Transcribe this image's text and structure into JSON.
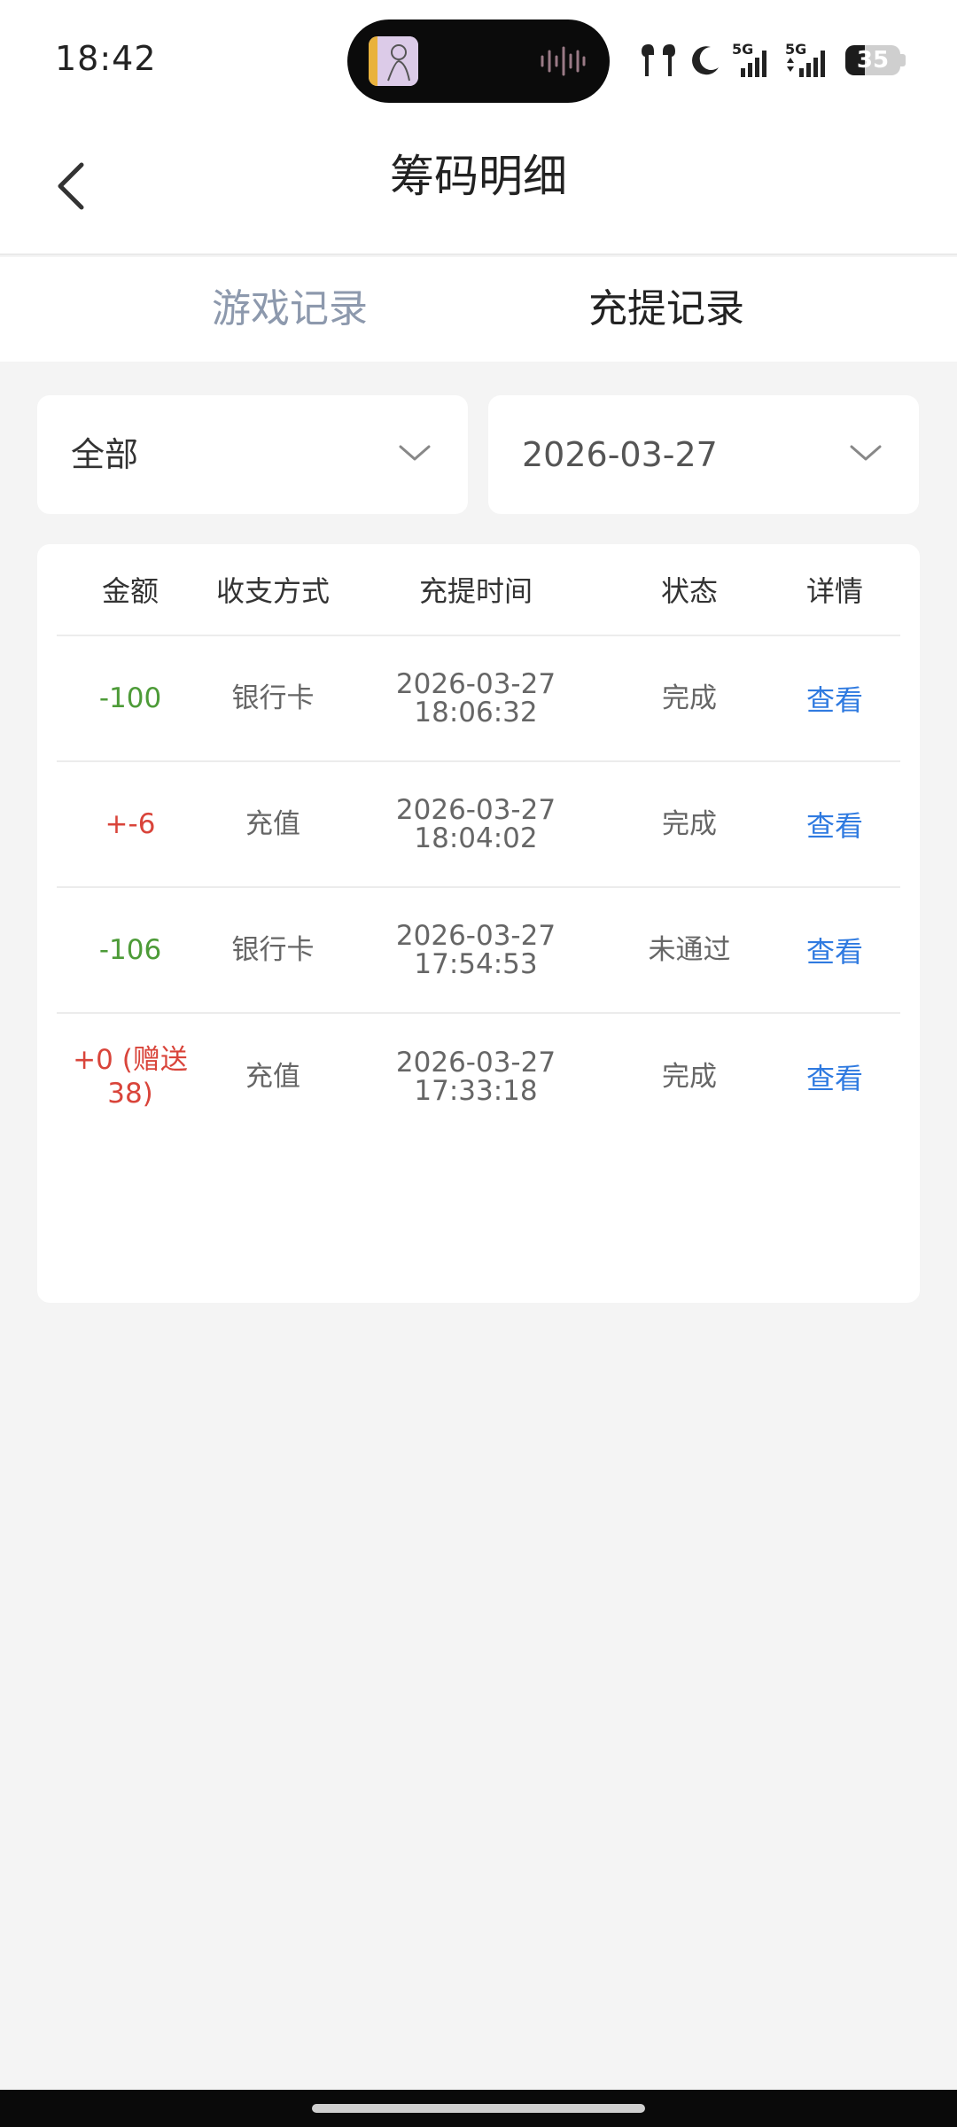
{
  "status_bar": {
    "time": "18:42",
    "battery_level": "35",
    "battery_fraction": 0.35,
    "network_1": "5G",
    "network_2": "5G"
  },
  "header": {
    "title": "筹码明细",
    "back_icon": "chevron-left-icon"
  },
  "tabs": [
    {
      "label": "游戏记录",
      "active": false
    },
    {
      "label": "充提记录",
      "active": true
    }
  ],
  "filters": {
    "type_value": "全部",
    "date_value": "2026-03-27"
  },
  "table": {
    "headers": [
      "金额",
      "收支方式",
      "充提时间",
      "状态",
      "详情"
    ],
    "rows": [
      {
        "amount": "-100",
        "method": "银行卡",
        "date": "2026-03-27",
        "time": "18:06:32",
        "status": "完成",
        "action": "查看",
        "sign": "neg"
      },
      {
        "amount": "+-6",
        "method": "充值",
        "date": "2026-03-27",
        "time": "18:04:02",
        "status": "完成",
        "action": "查看",
        "sign": "pos"
      },
      {
        "amount": "-106",
        "method": "银行卡",
        "date": "2026-03-27",
        "time": "17:54:53",
        "status": "未通过",
        "action": "查看",
        "sign": "neg"
      },
      {
        "amount": "+0 (赠送38)",
        "method": "充值",
        "date": "2026-03-27",
        "time": "17:33:18",
        "status": "完成",
        "action": "查看",
        "sign": "pos"
      }
    ]
  },
  "colors": {
    "negative": "#4d9b38",
    "positive": "#d9443a",
    "link": "#2f7ae0",
    "inactive_tab": "#8d99ad",
    "background": "#f4f4f4"
  }
}
